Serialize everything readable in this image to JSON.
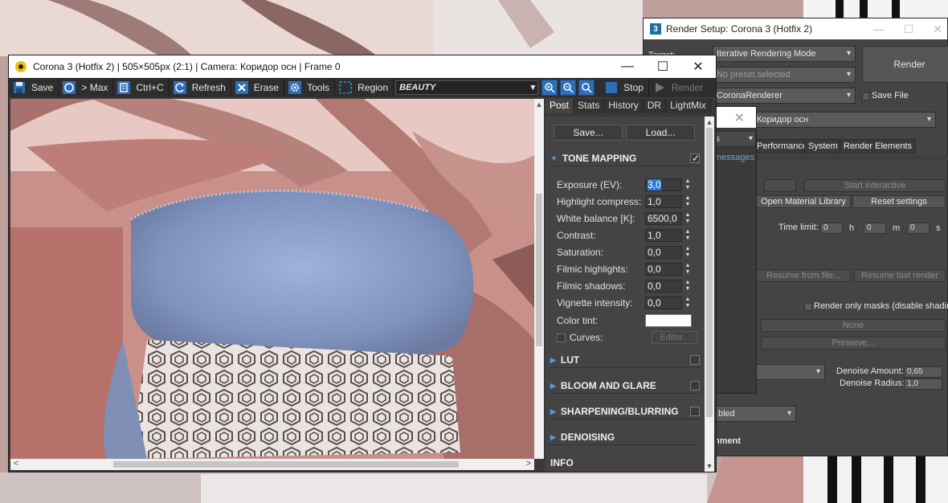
{
  "render_setup": {
    "title": "Render Setup: Corona 3 (Hotfix 2)",
    "target_label": "Target:",
    "target_value": "Iterative Rendering Mode",
    "preset_value": "No preset selected",
    "renderer_value": "CoronaRenderer",
    "view_value": "Коридор осн",
    "render_button": "Render",
    "save_file_label": "Save File",
    "tabs": [
      "Performance",
      "System",
      "Render Elements"
    ],
    "start_interactive": "Start interactive",
    "open_material_library": "Open Material Library",
    "reset_settings": "Reset settings",
    "time_limit_label": "Time limit:",
    "time_h": "0",
    "time_h_unit": "h",
    "time_m": "0",
    "time_m_unit": "m",
    "time_s": "0",
    "time_s_unit": "s",
    "resume_from_file": "Resume from file...",
    "resume_last_render": "Resume last render",
    "render_only_masks": "Render only masks (disable shading)",
    "none_button": "None",
    "preserve_button": "Preserve...",
    "denoise_amount_label": "Denoise Amount:",
    "denoise_amount_value": "0,65",
    "denoise_radius_label": "Denoise Radius:",
    "denoise_radius_value": "1,0",
    "enabled_dropdown": "bled",
    "section_label": "nment"
  },
  "messages_dialog": {
    "dropdown": "ngs",
    "link": "messages"
  },
  "vfb": {
    "title": "Corona 3 (Hotfix 2) | 505×505px (2:1) | Camera: Коридор осн | Frame 0",
    "toolbar": {
      "save": "Save",
      "to_max": "> Max",
      "copy": "Ctrl+C",
      "refresh": "Refresh",
      "erase": "Erase",
      "tools": "Tools",
      "region": "Region",
      "pass": "BEAUTY",
      "stop": "Stop",
      "render": "Render"
    },
    "panel": {
      "tabs": [
        "Post",
        "Stats",
        "History",
        "DR",
        "LightMix"
      ],
      "save_btn": "Save...",
      "load_btn": "Load...",
      "tone_mapping": "TONE MAPPING",
      "params": [
        {
          "label": "Exposure (EV):",
          "value": "3,0"
        },
        {
          "label": "Highlight compress:",
          "value": "1,0"
        },
        {
          "label": "White balance [K]:",
          "value": "6500,0"
        },
        {
          "label": "Contrast:",
          "value": "1,0"
        },
        {
          "label": "Saturation:",
          "value": "0,0"
        },
        {
          "label": "Filmic highlights:",
          "value": "0,0"
        },
        {
          "label": "Filmic shadows:",
          "value": "0,0"
        },
        {
          "label": "Vignette intensity:",
          "value": "0,0"
        }
      ],
      "color_tint": "Color tint:",
      "curves": "Curves:",
      "editor": "Editor...",
      "sections": [
        "LUT",
        "BLOOM AND GLARE",
        "SHARPENING/BLURRING",
        "DENOISING",
        "INFO"
      ]
    }
  },
  "colors": {
    "accent": "#2f6fb5",
    "panel_bg": "#444444",
    "toolbar_bg": "#2e2e2e"
  }
}
